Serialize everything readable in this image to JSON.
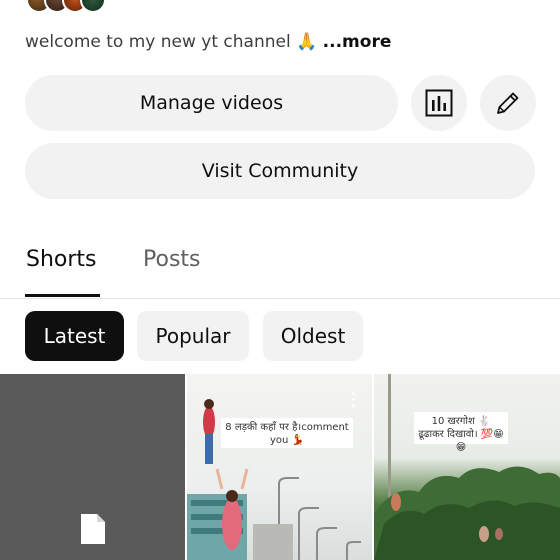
{
  "header": {
    "description": "welcome to my new yt channel 🙏 ",
    "more_label": "...more"
  },
  "actions": {
    "manage_label": "Manage videos",
    "community_label": "Visit Community",
    "stats_icon": "analytics-icon",
    "edit_icon": "pencil-icon"
  },
  "tabs": [
    {
      "label": "Shorts",
      "selected": true
    },
    {
      "label": "Posts",
      "selected": false
    }
  ],
  "filters": [
    {
      "label": "Latest",
      "selected": true
    },
    {
      "label": "Popular",
      "selected": false
    },
    {
      "label": "Oldest",
      "selected": false
    }
  ],
  "shorts": [
    {
      "caption": "",
      "icon": "file-icon"
    },
    {
      "caption": "8 लड़की कहाँ पर है।comment you 💃"
    },
    {
      "caption": "10 खरगोश 🐇 ढूढाकर दिखावो। 💯😁😁"
    }
  ],
  "colors": {
    "chip_active_bg": "#0f0f0f",
    "chip_bg": "#f2f2f2",
    "tab_inactive": "#606060"
  }
}
